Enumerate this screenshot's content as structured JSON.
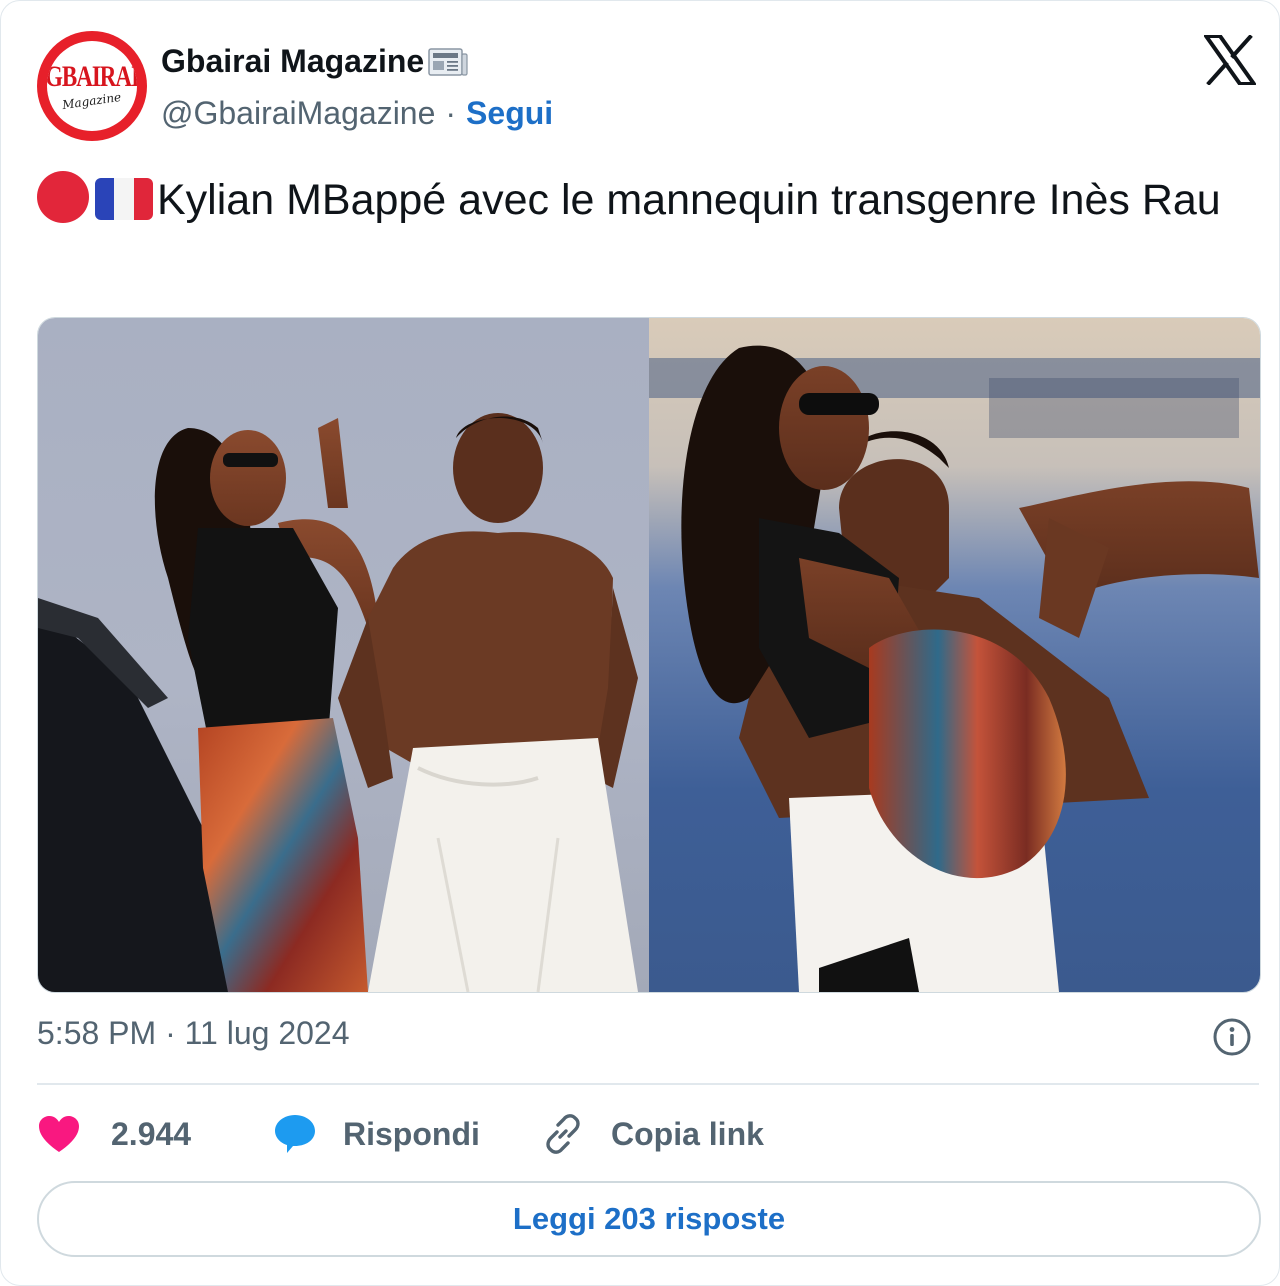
{
  "account": {
    "name": "Gbairai Magazine",
    "handle": "@GbairaiMagazine",
    "separator": "·",
    "follow_label": "Segui",
    "avatar_text": "GBAIRAI",
    "avatar_subtext": "Magazine",
    "avatar_icon": "gbairai-logo",
    "name_suffix_icon": "newspaper-icon"
  },
  "platform_icon": "x-logo",
  "tweet": {
    "text": "Kylian MBappé avec le mannequin transgenre Inès Rau",
    "prefix_emojis": [
      "red-circle-emoji",
      "france-flag-emoji"
    ]
  },
  "media": {
    "photos": [
      {
        "description_icon": "photo-left"
      },
      {
        "description_icon": "photo-right"
      }
    ]
  },
  "meta": {
    "timestamp": "5:58 PM · 11 lug 2024",
    "info_icon": "info-icon"
  },
  "actions": {
    "like_count": "2.944",
    "reply_label": "Rispondi",
    "copy_link_label": "Copia link"
  },
  "read_replies_label": "Leggi 203 risposte",
  "colors": {
    "accent": "#1d6fc7",
    "like": "#f91880",
    "reply": "#1d9bf0",
    "muted": "#536471",
    "avatar_ring": "#e7202a"
  }
}
